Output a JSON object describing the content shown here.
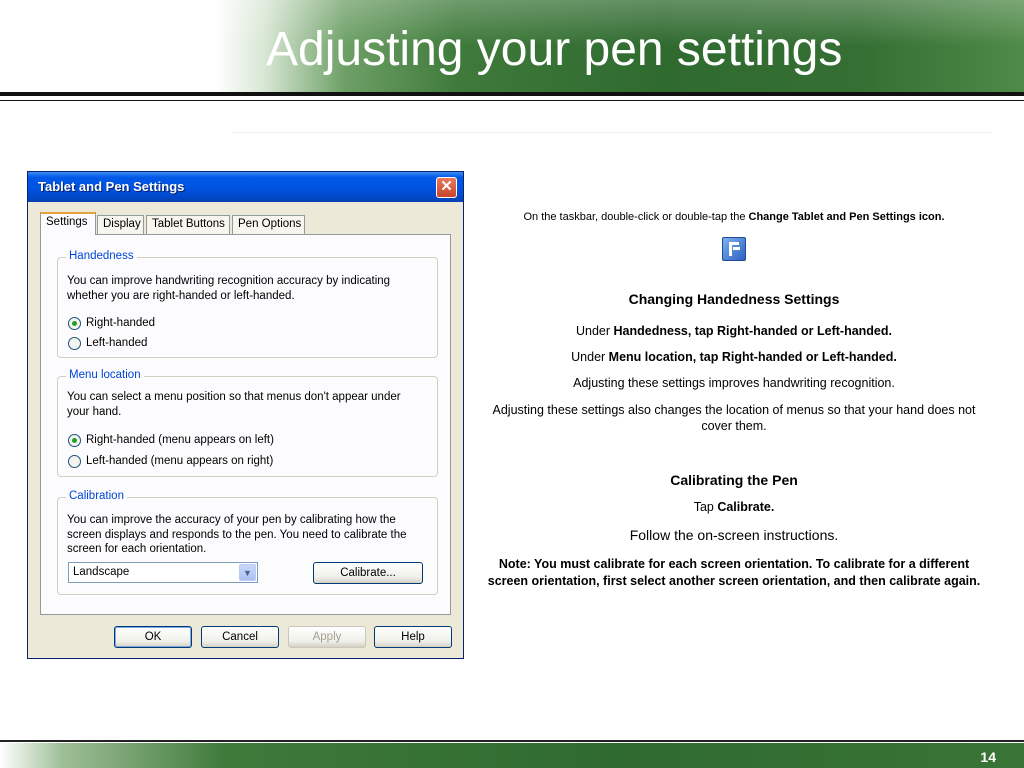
{
  "slide": {
    "title": "Adjusting your pen settings",
    "page_number": "14"
  },
  "dialog": {
    "title": "Tablet and Pen Settings",
    "close_glyph": "✕",
    "tabs": [
      {
        "label": "Settings",
        "active": true
      },
      {
        "label": "Display",
        "active": false
      },
      {
        "label": "Tablet Buttons",
        "active": false
      },
      {
        "label": "Pen Options",
        "active": false
      }
    ],
    "handedness": {
      "label": "Handedness",
      "text_line1": "You can improve handwriting recognition accuracy by indicating",
      "text_line2": "whether you are right-handed or left-handed.",
      "option1": "Right-handed",
      "option2": "Left-handed",
      "selected": "Right-handed"
    },
    "menu_location": {
      "label": "Menu location",
      "text_line1": "You can select a menu position so that menus don't appear under",
      "text_line2": "your hand.",
      "option1": "Right-handed (menu appears on left)",
      "option2": "Left-handed (menu appears on right)",
      "selected": "Right-handed (menu appears on left)"
    },
    "calibration": {
      "label": "Calibration",
      "text_line1": "You can improve the accuracy of your pen by calibrating how the",
      "text_line2": "screen displays and responds to the pen. You need to calibrate the",
      "text_line3": "screen for each orientation.",
      "orientation_value": "Landscape",
      "calibrate_button": "Calibrate..."
    },
    "buttons": {
      "ok": "OK",
      "cancel": "Cancel",
      "apply": "Apply",
      "help": "Help"
    }
  },
  "instructions": {
    "intro_prefix": "On the taskbar, double-click or double-tap the ",
    "intro_bold": "Change Tablet and Pen Settings icon.",
    "icon_name": "tablet-pen-settings-icon",
    "handedness_heading": "Changing Handedness Settings",
    "line1_prefix": "Under ",
    "line1_bold": "Handedness, tap Right-handed or Left-handed.",
    "line2_prefix": "Under ",
    "line2_bold": "Menu location, tap Right-handed or Left-handed.",
    "line3": "Adjusting these settings improves handwriting recognition.",
    "line4": "Adjusting these settings also changes the location of menus so that your hand does not cover them.",
    "calibrating_heading": "Calibrating the Pen",
    "tap_prefix": "Tap ",
    "tap_bold": "Calibrate.",
    "follow": "Follow the on-screen instructions.",
    "note": "Note: You must calibrate for each screen orientation. To calibrate for a different screen orientation, first select another screen orientation, and then calibrate again."
  },
  "colors": {
    "banner_green": "#2f6a2f",
    "titlebar_blue": "#0054e3",
    "group_label_blue": "#0046d5"
  }
}
